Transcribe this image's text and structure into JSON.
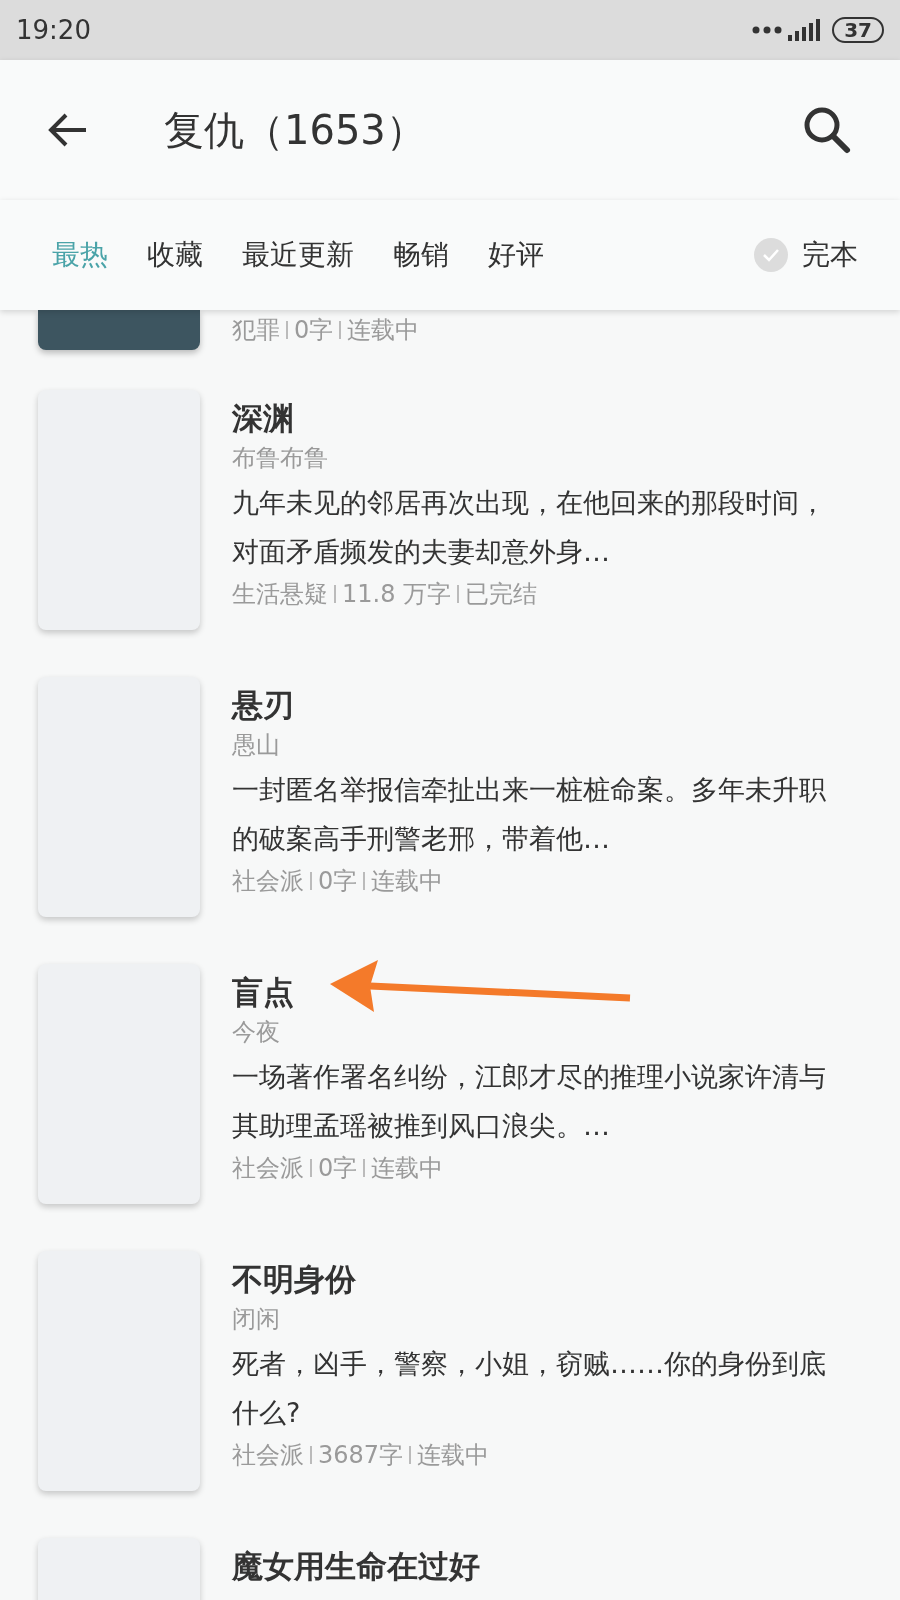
{
  "status_bar": {
    "time": "19:20",
    "battery": "37"
  },
  "header": {
    "title": "复仇（1653）"
  },
  "sort_tabs": [
    {
      "label": "最热",
      "selected": true
    },
    {
      "label": "收藏",
      "selected": false
    },
    {
      "label": "最近更新",
      "selected": false
    },
    {
      "label": "畅销",
      "selected": false
    },
    {
      "label": "好评",
      "selected": false
    }
  ],
  "finished_filter": {
    "label": "完本",
    "checked": false
  },
  "books": [
    {
      "kind": "partial",
      "meta": [
        "犯罪",
        "0字",
        "连载中"
      ]
    },
    {
      "kind": "full",
      "title": "深渊",
      "author": "布鲁布鲁",
      "description": "九年未见的邻居再次出现，在他回来的那段时间，对面矛盾频发的夫妻却意外身…",
      "meta": [
        "生活悬疑",
        "11.8 万字",
        "已完结"
      ]
    },
    {
      "kind": "full",
      "title": "悬刃",
      "author": "愚山",
      "description": "一封匿名举报信牵扯出来一桩桩命案。多年未升职的破案高手刑警老邢，带着他…",
      "meta": [
        "社会派",
        "0字",
        "连载中"
      ]
    },
    {
      "kind": "full",
      "title": "盲点",
      "author": "今夜",
      "description": "一场著作署名纠纷，江郎才尽的推理小说家许清与其助理孟瑶被推到风口浪尖。…",
      "meta": [
        "社会派",
        "0字",
        "连载中"
      ]
    },
    {
      "kind": "full",
      "title": "不明身份",
      "author": "闭闲",
      "description": "死者，凶手，警察，小姐，窃贼……你的身份到底什么?",
      "meta": [
        "社会派",
        "3687字",
        "连载中"
      ]
    },
    {
      "kind": "title_only",
      "title": "魔女用生命在过好"
    }
  ]
}
